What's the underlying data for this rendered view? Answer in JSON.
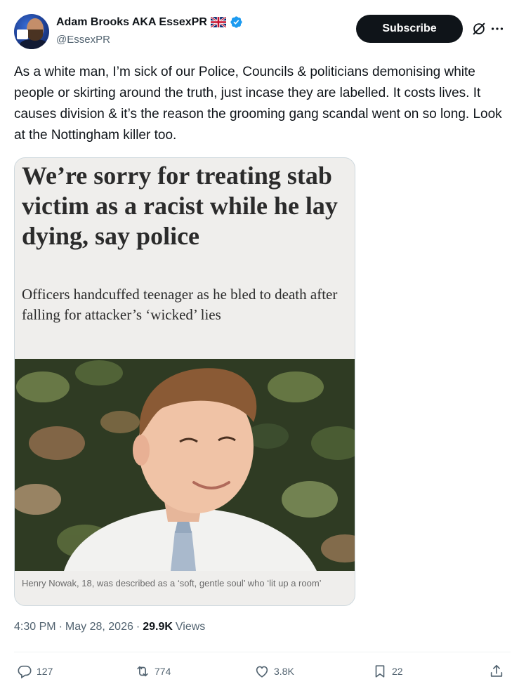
{
  "author": {
    "display_name": "Adam Brooks AKA EssexPR",
    "handle": "@EssexPR",
    "verified": true,
    "flag_icon": "uk-flag-icon"
  },
  "header": {
    "subscribe_label": "Subscribe",
    "grok_icon": "grok-icon",
    "more_icon": "more-icon"
  },
  "tweet": {
    "text": "As a white man, I’m sick of our Police, Councils & politicians demonising white people or skirting around the truth, just incase they are labelled. It costs lives. It causes division & it’s the reason the grooming gang scandal went on so long. Look at the Nottingham killer too."
  },
  "media": {
    "headline": "We’re sorry for treating stab victim as a racist while he lay dying, say police",
    "standfirst": "Officers handcuffed teenager as he bled to death after falling for attacker’s ‘wicked’ lies",
    "caption": "Henry Nowak, 18, was described as a ‘soft, gentle soul’ who ‘lit up a room’"
  },
  "meta": {
    "time": "4:30 PM",
    "separator": "·",
    "date": "May 28, 2026",
    "views_count": "29.9K",
    "views_label": "Views"
  },
  "actions": {
    "replies": "127",
    "reposts": "774",
    "likes": "3.8K",
    "bookmarks": "22"
  },
  "colors": {
    "text_primary": "#0f1419",
    "text_secondary": "#536471",
    "verified_blue": "#1d9bf0",
    "button_bg": "#0f1419"
  }
}
